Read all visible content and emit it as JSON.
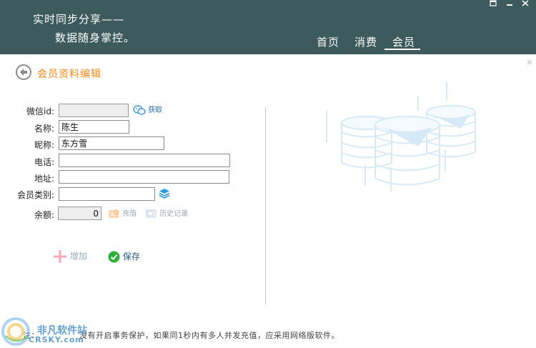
{
  "header": {
    "slogan_line1": "实时同步分享——",
    "slogan_line2": "数据随身掌控。",
    "nav": [
      {
        "label": "首页"
      },
      {
        "label": "消费"
      },
      {
        "label": "会员",
        "active": true
      }
    ],
    "window_controls": [
      "restore-icon",
      "minimize-icon",
      "close-icon"
    ]
  },
  "page": {
    "title": "会员资料编辑"
  },
  "form": {
    "wechat_id": {
      "label": "微信id:",
      "value": "",
      "action_label": "获取"
    },
    "name": {
      "label": "名称:",
      "value": "陈生"
    },
    "nickname": {
      "label": "昵称:",
      "value": "东方雪"
    },
    "phone": {
      "label": "电话:",
      "value": ""
    },
    "address": {
      "label": "地址:",
      "value": ""
    },
    "member_type": {
      "label": "会员类别:",
      "value": ""
    },
    "balance": {
      "label": "余额:",
      "value": "0",
      "recharge_label": "充值",
      "history_label": "历史记录"
    }
  },
  "actions": {
    "add_label": "增加",
    "save_label": "保存"
  },
  "footer": {
    "note_part1": "注：",
    "note_part2": "没有开启事务保护，如果同1秒内有多人并发充值，应采用网络版软件。"
  },
  "watermark": {
    "cn": "非凡软件站",
    "en": "CRSKY.com"
  },
  "colors": {
    "header_bg": "#3d5a5c",
    "title_orange": "#f08a16",
    "link_blue": "#2b6cb0",
    "save_green": "#2fae3a",
    "add_pink": "#f4a9b8"
  }
}
